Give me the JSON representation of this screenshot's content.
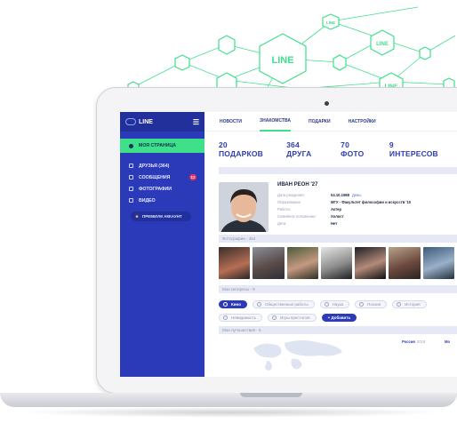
{
  "network": {
    "nodes": [
      "LINE",
      "LINE",
      "LINE",
      "LINE"
    ]
  },
  "app": {
    "logo_text": "LINE",
    "sidebar": {
      "active_item": "МОЯ СТРАНИЦА",
      "items": [
        {
          "label": "ДРУЗЬЯ (364)",
          "icon": "friends-icon",
          "badge": ""
        },
        {
          "label": "СООБЩЕНИЯ",
          "icon": "messages-icon",
          "badge": "12"
        },
        {
          "label": "ФОТОГРАФИИ",
          "icon": "photos-icon",
          "badge": ""
        },
        {
          "label": "ВИДЕО",
          "icon": "video-icon",
          "badge": ""
        }
      ],
      "premium_label": "ПРЕМИУМ АККАУНТ"
    },
    "topnav": {
      "tabs": [
        "НОВОСТИ",
        "ЗНАКОМСТВА",
        "ПОДАРКИ",
        "НАСТРОЙКИ"
      ],
      "active_tab": "ЗНАКОМСТВА"
    },
    "stats": [
      "20 ПОДАРКОВ",
      "364 ДРУГА",
      "70 ФОТО",
      "9 ИНТЕРЕСОВ"
    ],
    "profile": {
      "name": "ИВАН РЕОН '27",
      "fields": [
        {
          "key": "Дата рождения:",
          "value": "04.10.1988",
          "extra": "Девы"
        },
        {
          "key": "Образование:",
          "value": "МГУ - Факультет философии и искусств '10",
          "extra": ""
        },
        {
          "key": "Работа:",
          "value": "Актер",
          "extra": ""
        },
        {
          "key": "Семейное положение:",
          "value": "Холост",
          "extra": ""
        },
        {
          "key": "Дети:",
          "value": "Нет",
          "extra": ""
        }
      ]
    },
    "photos_head": "Фотографии - 364",
    "interests_head": "Мои интересы - 9",
    "interests_row1": [
      "Кино",
      "Общественные работы",
      "Наука",
      "Поэзия",
      "История"
    ],
    "interests_row2": [
      "Невидимость",
      "Игры престолов"
    ],
    "add_label": "+ Добавить",
    "travels_head": "Мои путешествия - 5",
    "travels": [
      {
        "country": "Россия",
        "year": "2016"
      },
      {
        "country": "Мо",
        "year": ""
      }
    ],
    "colors": {
      "sidebar": "#2b3ab8",
      "accent": "#3fe08a",
      "badge": "#e8305a"
    }
  }
}
